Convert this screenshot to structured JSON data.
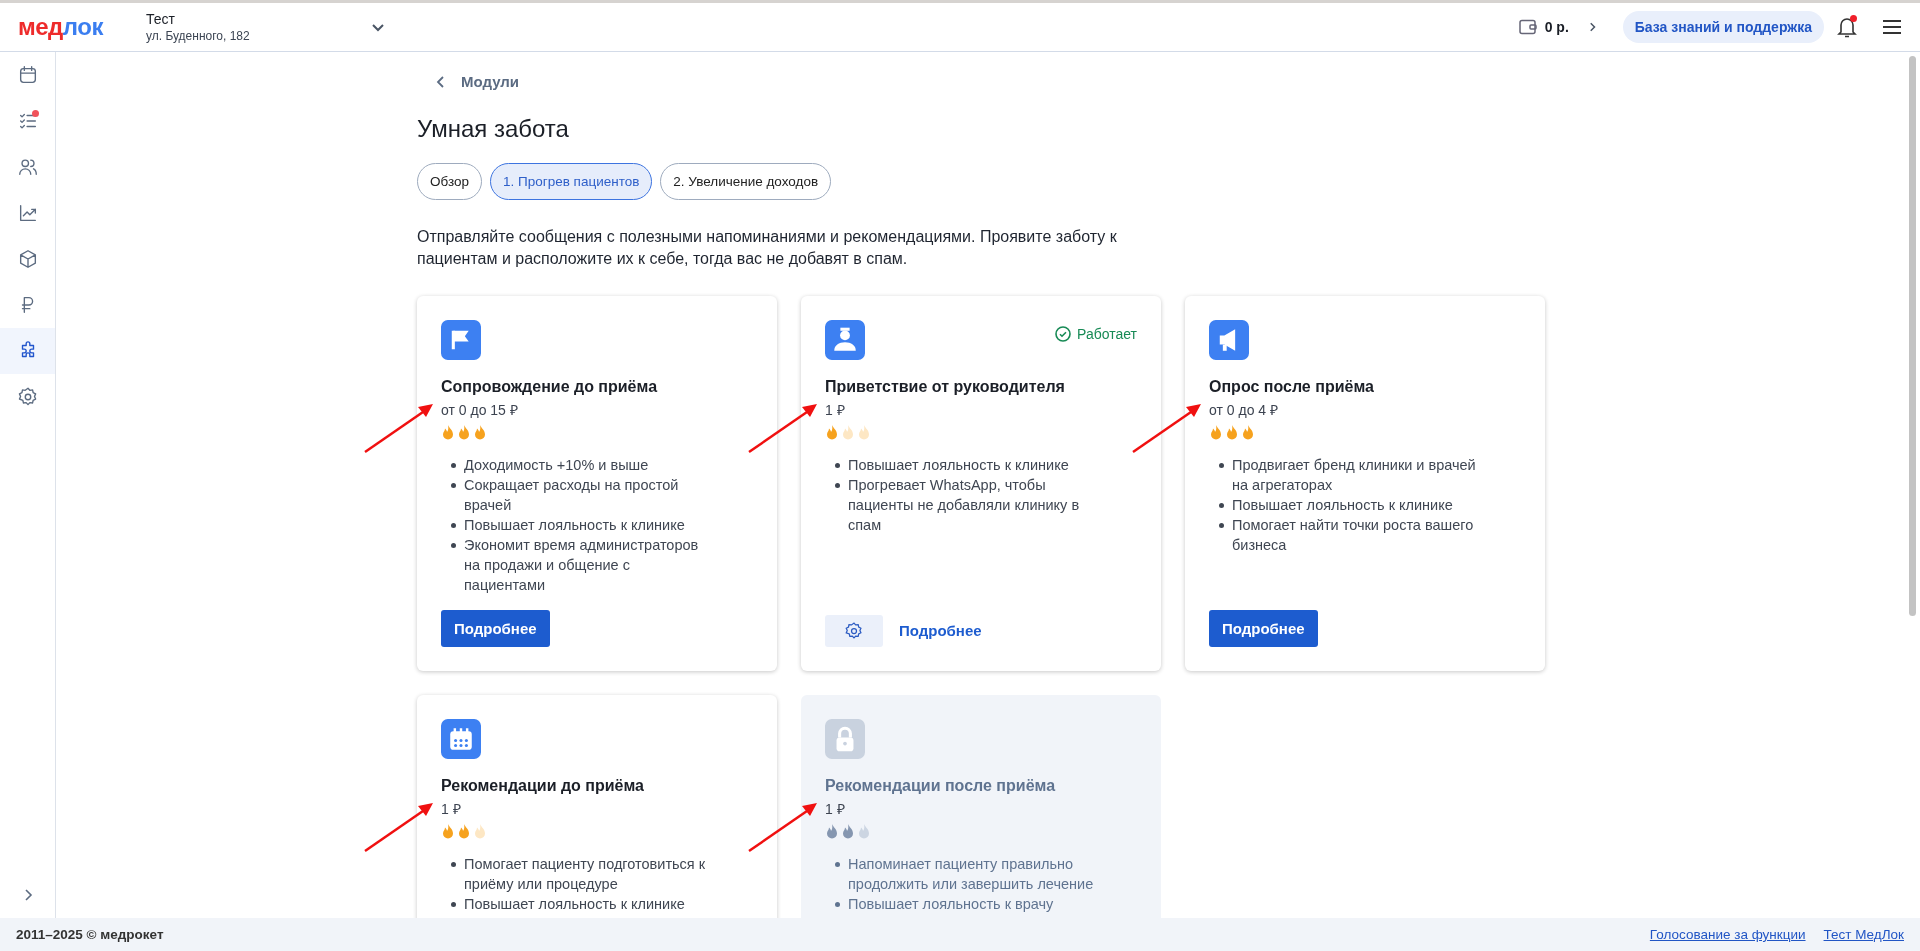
{
  "header": {
    "logo": {
      "part_1": "мед",
      "part_2": "лок"
    },
    "clinic": {
      "name": "Тест",
      "address": "ул. Буденного, 182"
    },
    "balance": "0 р.",
    "support_button": "База знаний и поддержка",
    "notifications": true
  },
  "sidebar": {
    "items": [
      {
        "selected": false,
        "badge": false
      },
      {
        "selected": false,
        "badge": true
      },
      {
        "selected": false,
        "badge": false
      },
      {
        "selected": false,
        "badge": false
      },
      {
        "selected": false,
        "badge": false
      },
      {
        "selected": false,
        "badge": false
      },
      {
        "selected": true,
        "badge": false
      },
      {
        "selected": false,
        "badge": false
      }
    ]
  },
  "back_link": "Модули",
  "title": "Умная забота",
  "tabs": [
    {
      "label": "Обзор",
      "selected": false
    },
    {
      "label": "1. Прогрев пациентов",
      "selected": true
    },
    {
      "label": "2. Увеличение доходов",
      "selected": false
    }
  ],
  "description": "Отправляйте сообщения с полезными напоминаниями и рекомендациями. Проявите заботу к пациентам и расположите их к себе, тогда вас не добавят в спам.",
  "cards": [
    {
      "title": "Сопровождение до приёма",
      "price": "от 0 до 15 ₽",
      "stars": 3,
      "locked": false,
      "annotated": true,
      "bullets": [
        "Доходимость +10% и выше",
        "Сокращает расходы на простой врачей",
        "Повышает лояльность к клинике",
        "Экономит время администраторов на продажи и общение с пациентами"
      ],
      "action": {
        "kind": "primary",
        "label": "Подробнее"
      }
    },
    {
      "title": "Приветствие от руководителя",
      "price": "1 ₽",
      "stars": 1,
      "locked": false,
      "annotated": true,
      "status": "Работает",
      "bullets": [
        "Повышает лояльность к клинике",
        "Прогревает WhatsApp, чтобы пациенты не добавляли клинику в спам"
      ],
      "action": {
        "kind": "settings_link",
        "label": "Подробнее"
      }
    },
    {
      "title": "Опрос после приёма",
      "price": "от 0 до 4 ₽",
      "stars": 3,
      "locked": false,
      "annotated": true,
      "bullets": [
        "Продвигает бренд клиники и врачей на агрегаторах",
        "Повышает лояльность к клинике",
        "Помогает найти точки роста вашего бизнеса"
      ],
      "action": {
        "kind": "primary",
        "label": "Подробнее"
      }
    },
    {
      "title": "Рекомендации до приёма",
      "price": "1 ₽",
      "stars": 2,
      "locked": false,
      "annotated": true,
      "bullets": [
        "Помогает пациенту подготовиться к приёму или процедуре",
        "Повышает лояльность к клинике"
      ]
    },
    {
      "title": "Рекомендации после приёма",
      "price": "1 ₽",
      "stars": 2,
      "locked": true,
      "annotated": true,
      "bullets": [
        "Напоминает пациенту правильно продолжить или завершить лечение",
        "Повышает лояльность к врачу"
      ]
    }
  ],
  "footer": {
    "copyright": "2011–2025 © медрокет",
    "links": [
      "Голосование за функции",
      "Тест МедЛок"
    ]
  }
}
